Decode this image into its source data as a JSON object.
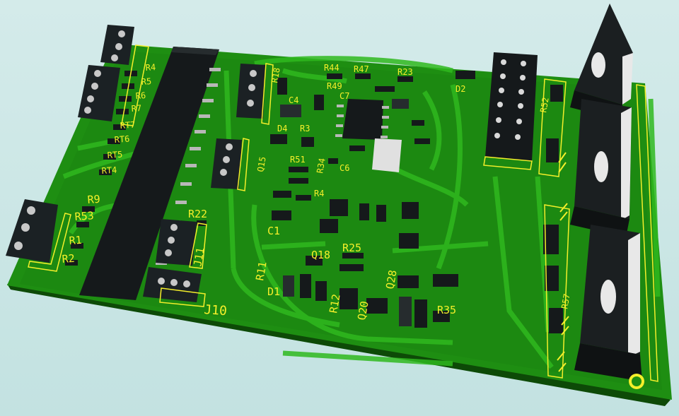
{
  "colors": {
    "board": "#1e8e12",
    "board_dark": "#166b0c",
    "board_edge": "#0d4a07",
    "trace": "#2fb91e",
    "silkscreen": "#f4ef2a",
    "component_black": "#15191b",
    "component_dark": "#262c2e",
    "pad_metal": "#c8c8c8",
    "heatsink_tab": "#e8e8e8"
  },
  "labels": {
    "r4": "R4",
    "r5": "R5",
    "r6": "R6",
    "r7": "R7",
    "rt7": "RT7",
    "rt6": "RT6",
    "rt5": "RT5",
    "rt4": "RT4",
    "r9": "R9",
    "r53": "R53",
    "r1": "R1",
    "r2": "R2",
    "r22": "R22",
    "j11": "J11",
    "j10": "J10",
    "r18": "R18",
    "r44": "R44",
    "r47": "R47",
    "r23": "R23",
    "r49": "R49",
    "c4": "C4",
    "c7": "C7",
    "d2": "D2",
    "d4": "D4",
    "r3": "R3",
    "r51": "R51",
    "r34": "R34",
    "c6": "C6",
    "r4x": "R4",
    "q15": "Q15",
    "c1": "C1",
    "q18": "Q18",
    "r25": "R25",
    "r11": "R11",
    "d1": "D1",
    "r12": "R12",
    "q20": "Q20",
    "q28": "Q28",
    "r35": "R35",
    "r52": "R52",
    "r57": "R57"
  }
}
